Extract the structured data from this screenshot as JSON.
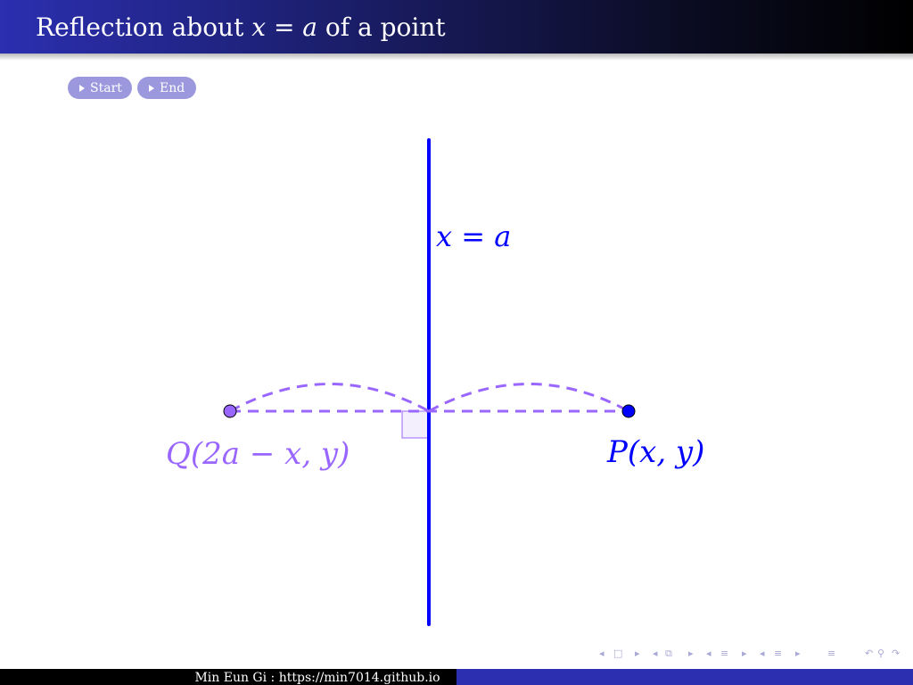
{
  "header": {
    "title_pre": "Reflection about ",
    "title_math": "x = a",
    "title_post": " of a point"
  },
  "buttons": {
    "start_label": "Start",
    "end_label": "End"
  },
  "diagram": {
    "line_label": "x = a",
    "point_p_label": "P(x, y)",
    "point_q_label": "Q(2a − x, y)",
    "colors": {
      "axis_line": "#0000ff",
      "point_p": "#0000ff",
      "reflection": "#9966ff",
      "right_angle_fill": "#f3effd"
    }
  },
  "nav_icons": [
    "nav-prev-frame-icon",
    "nav-frame-icon",
    "nav-next-frame-icon",
    "nav-prev-slide-icon",
    "nav-slide-icon",
    "nav-next-slide-icon",
    "nav-prev-section-icon",
    "nav-section-icon",
    "nav-next-section-icon",
    "nav-subsection-icon",
    "nav-search-icon"
  ],
  "footer": {
    "text": "Min Eun Gi : https://min7014.github.io"
  }
}
